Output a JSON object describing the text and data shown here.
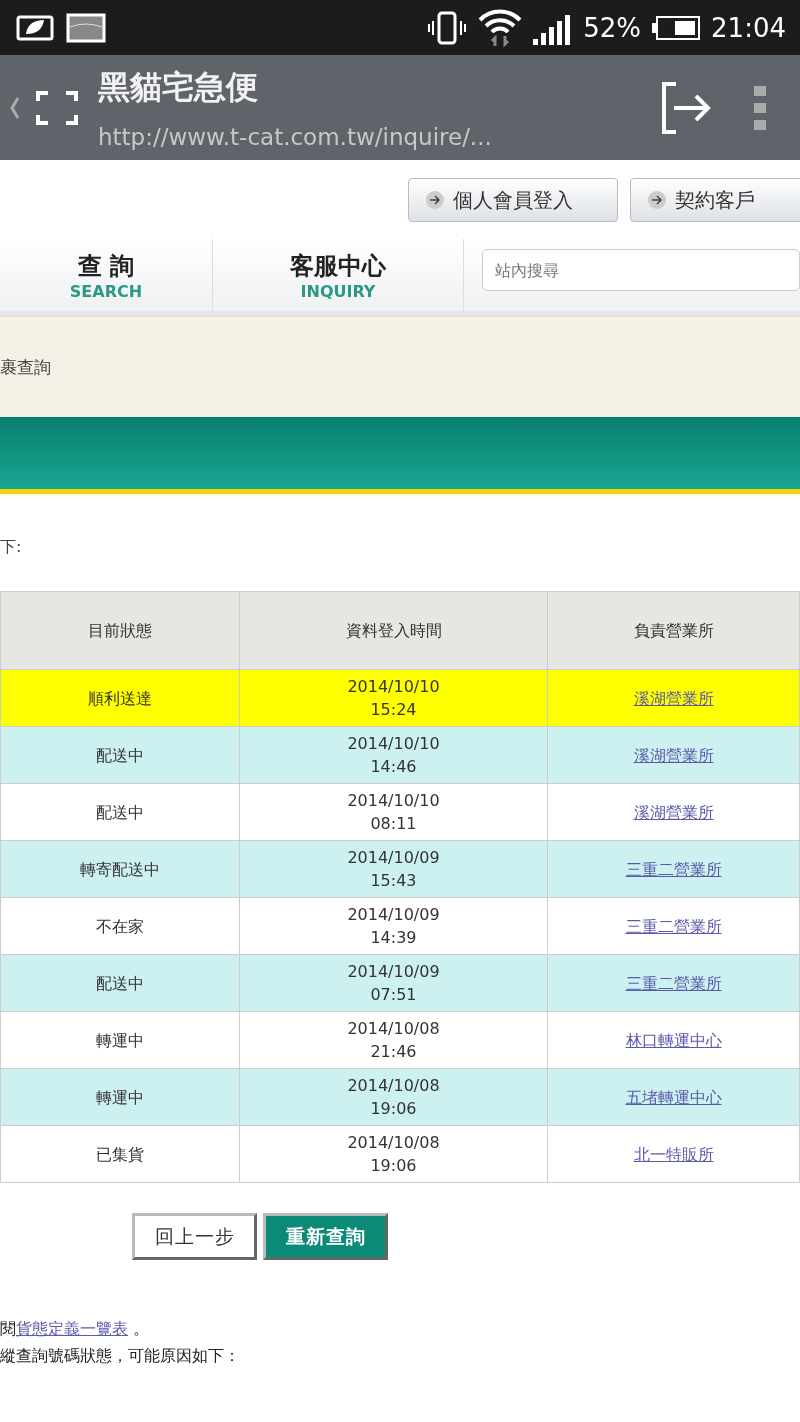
{
  "status_bar": {
    "battery_text": "52%",
    "time": "21:04"
  },
  "browser": {
    "title": "黑貓宅急便",
    "url": "http://www.t-cat.com.tw/inquire/..."
  },
  "header": {
    "login_buttons": [
      "個人會員登入",
      "契約客戶"
    ],
    "nav": [
      {
        "label": "查 詢",
        "sub": "SEARCH"
      },
      {
        "label": "客服中心",
        "sub": "INQUIRY"
      }
    ],
    "search": {
      "placeholder": "站內搜尋"
    }
  },
  "breadcrumb": "裹查詢",
  "intro": "下:",
  "table": {
    "columns": [
      "目前狀態",
      "資料登入時間",
      "負責營業所"
    ],
    "rows": [
      {
        "status": "順利送達",
        "date": "2014/10/10",
        "time": "15:24",
        "office": "溪湖營業所",
        "highlighted": true
      },
      {
        "status": "配送中",
        "date": "2014/10/10",
        "time": "14:46",
        "office": "溪湖營業所",
        "highlighted": false
      },
      {
        "status": "配送中",
        "date": "2014/10/10",
        "time": "08:11",
        "office": "溪湖營業所",
        "highlighted": false
      },
      {
        "status": "轉寄配送中",
        "date": "2014/10/09",
        "time": "15:43",
        "office": "三重二營業所",
        "highlighted": false
      },
      {
        "status": "不在家",
        "date": "2014/10/09",
        "time": "14:39",
        "office": "三重二營業所",
        "highlighted": false
      },
      {
        "status": "配送中",
        "date": "2014/10/09",
        "time": "07:51",
        "office": "三重二營業所",
        "highlighted": false
      },
      {
        "status": "轉運中",
        "date": "2014/10/08",
        "time": "21:46",
        "office": "林口轉運中心",
        "highlighted": false
      },
      {
        "status": "轉運中",
        "date": "2014/10/08",
        "time": "19:06",
        "office": "五堵轉運中心",
        "highlighted": false
      },
      {
        "status": "已集貨",
        "date": "2014/10/08",
        "time": "19:06",
        "office": "北一特販所",
        "highlighted": false
      }
    ]
  },
  "buttons": [
    {
      "label": "回上一步",
      "kind": "secondary"
    },
    {
      "label": "重新查詢",
      "kind": "primary"
    }
  ],
  "notes": [
    {
      "before": "閱",
      "link": "貨態定義一覽表",
      "after": " 。"
    },
    {
      "before": "縱查詢號碼狀態，可能原因如下："
    }
  ]
}
